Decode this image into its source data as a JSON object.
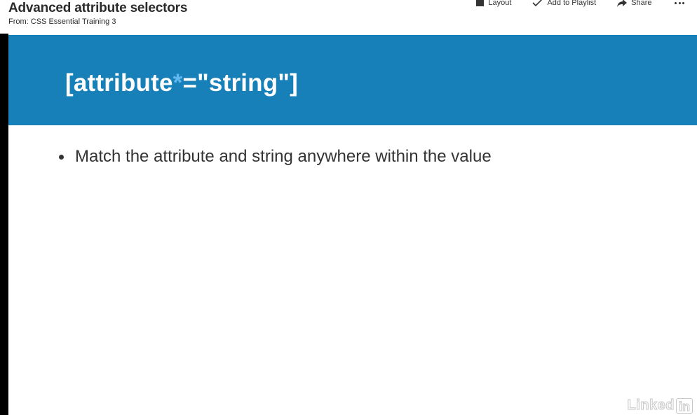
{
  "header": {
    "title": "Advanced attribute selectors",
    "from_label": "From: CSS Essential Training 3",
    "toolbar": {
      "layout": "Layout",
      "add_to_playlist": "Add to Playlist",
      "share": "Share"
    }
  },
  "slide": {
    "heading_prefix": "[attribute",
    "heading_operator": "*",
    "heading_suffix": "=\"string\"]",
    "bullets": [
      "Match the attribute and string anywhere within the value"
    ]
  },
  "watermark": {
    "text": "Linked",
    "box_text": "in"
  },
  "colors": {
    "banner": "#1780b9",
    "operator_highlight": "#62b8f0",
    "heading_text": "#ffffff",
    "body_text": "#333333"
  }
}
